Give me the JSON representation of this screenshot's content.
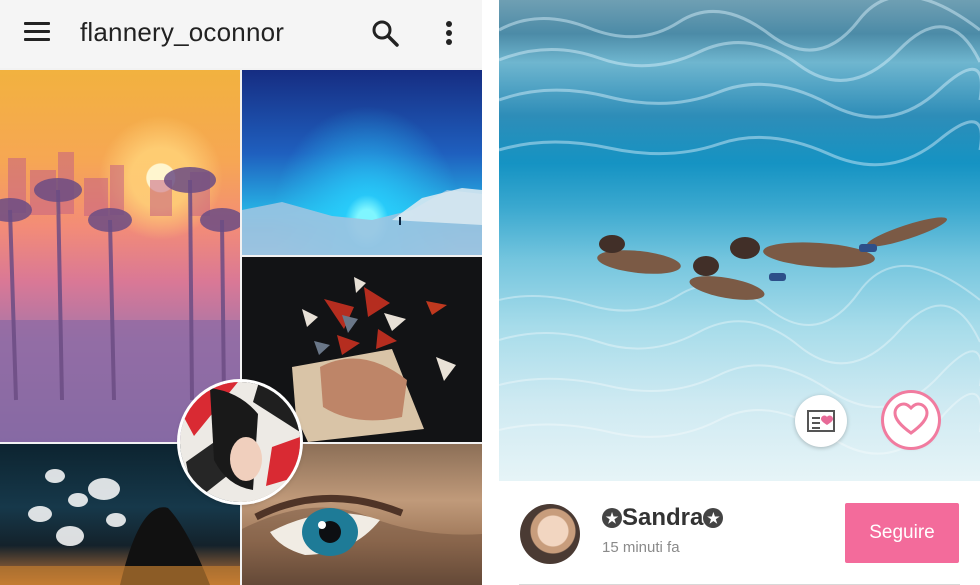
{
  "left_app": {
    "title": "flannery_oconnor",
    "icons": [
      "hamburger-menu-icon",
      "search-icon",
      "more-vertical-icon"
    ],
    "grid": [
      "sunset-palms-image",
      "aurora-night-image",
      "paper-collage-image",
      "jellyfish-image",
      "painted-eye-image"
    ],
    "floating_avatar": "profile-avatar-image"
  },
  "right_app": {
    "photo": "underwater-swimmers-image",
    "actions": [
      "postcard-heart-icon",
      "heart-icon"
    ],
    "user": {
      "name": "Sandra",
      "time": "15 minuti fa"
    },
    "follow_label": "Seguire"
  },
  "colors": {
    "accent": "#f36b9b",
    "like_ring": "#f17b9f",
    "text_dark": "#333333",
    "text_muted": "#8a8a8a"
  }
}
